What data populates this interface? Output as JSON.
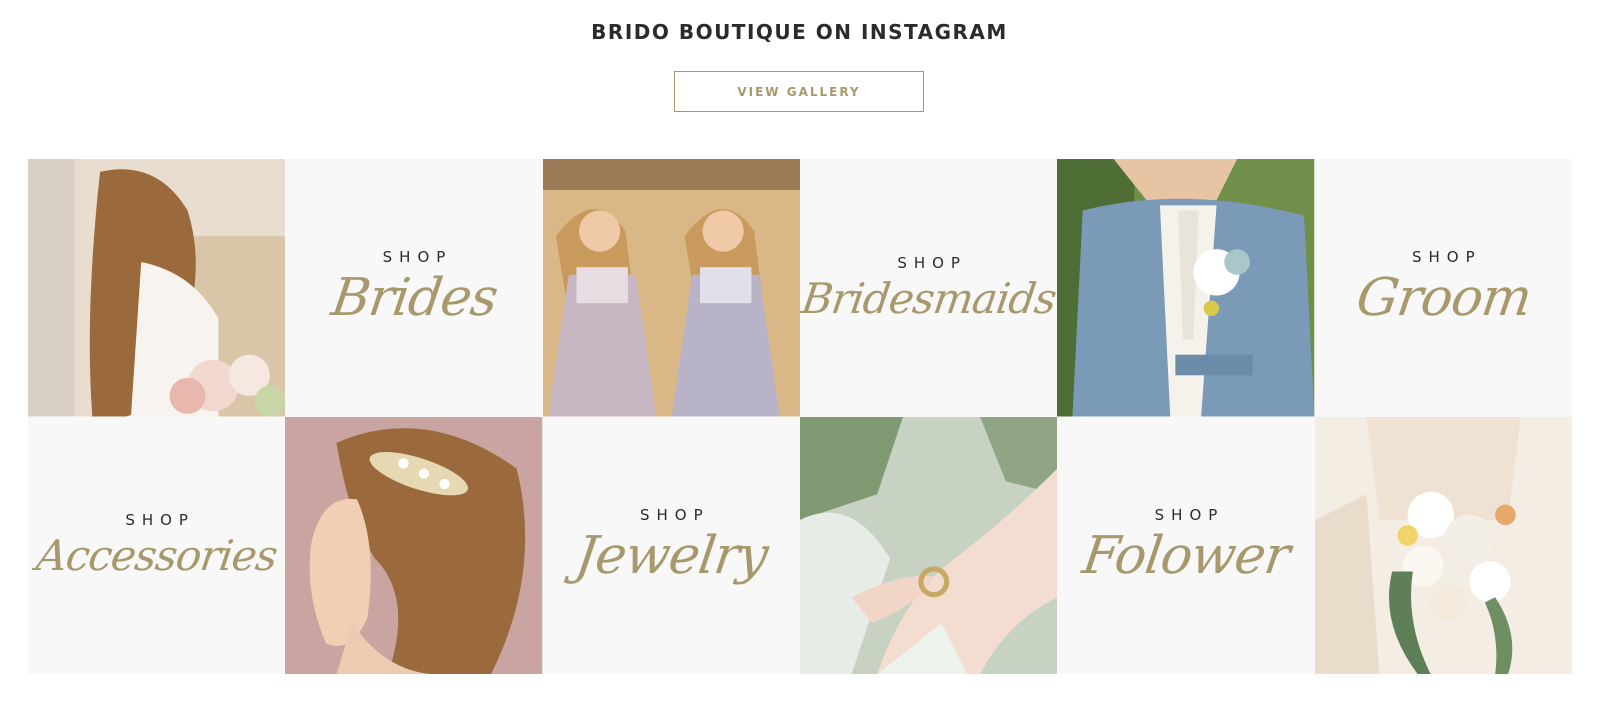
{
  "section": {
    "title": "BRIDO BOUTIQUE ON INSTAGRAM",
    "button_label": "VIEW GALLERY"
  },
  "tiles": {
    "brides": {
      "shop": "SHOP",
      "label": "Brides"
    },
    "bridesmaids": {
      "shop": "SHOP",
      "label": "Bridesmaids"
    },
    "groom": {
      "shop": "SHOP",
      "label": "Groom"
    },
    "accessories": {
      "shop": "SHOP",
      "label": "Accessories"
    },
    "jewelry": {
      "shop": "SHOP",
      "label": "Jewelry"
    },
    "flower": {
      "shop": "SHOP",
      "label": "Folower"
    }
  },
  "colors": {
    "accent": "#a8996c",
    "title": "#2b2b2b",
    "tile_bg": "#f8f8f8"
  }
}
